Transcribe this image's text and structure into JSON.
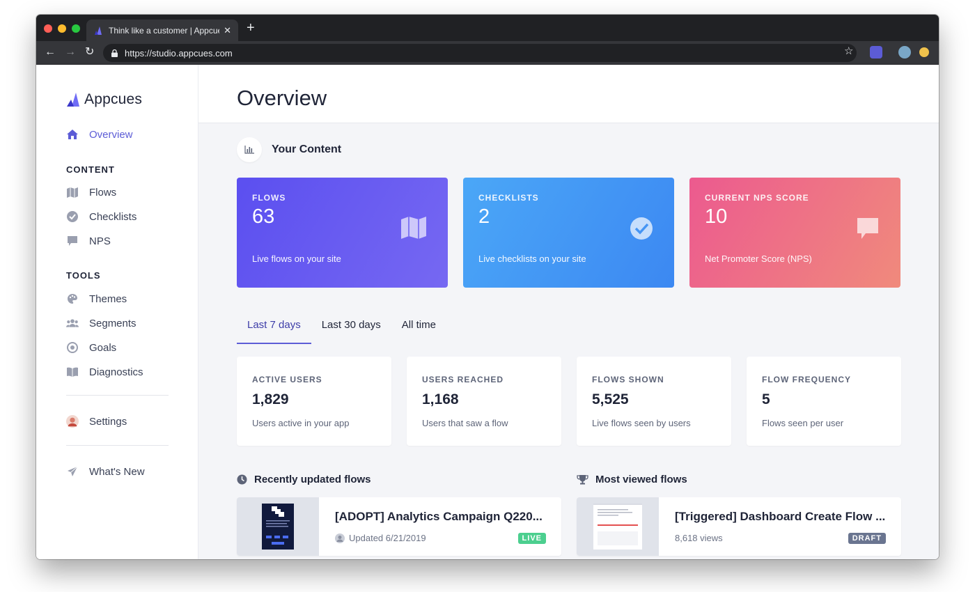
{
  "browser": {
    "tab_title": "Think like a customer | Appcues",
    "url": "https://studio.appcues.com",
    "traffic_lights": [
      "#ff5f57",
      "#febc2e",
      "#28c840"
    ]
  },
  "sidebar": {
    "logo_text": "Appcues",
    "overview_label": "Overview",
    "content_heading": "CONTENT",
    "content_items": [
      {
        "label": "Flows",
        "icon": "map-icon"
      },
      {
        "label": "Checklists",
        "icon": "check-circle-icon"
      },
      {
        "label": "NPS",
        "icon": "chat-bubble-icon"
      }
    ],
    "tools_heading": "TOOLS",
    "tools_items": [
      {
        "label": "Themes",
        "icon": "palette-icon"
      },
      {
        "label": "Segments",
        "icon": "users-icon"
      },
      {
        "label": "Goals",
        "icon": "target-icon"
      },
      {
        "label": "Diagnostics",
        "icon": "book-icon"
      }
    ],
    "settings_label": "Settings",
    "whats_new_label": "What's New"
  },
  "main": {
    "page_title": "Overview",
    "your_content_title": "Your Content",
    "cards": [
      {
        "label": "FLOWS",
        "value": "63",
        "sub": "Live flows on your site",
        "icon": "map-icon"
      },
      {
        "label": "CHECKLISTS",
        "value": "2",
        "sub": "Live checklists on your site",
        "icon": "check-circle-icon"
      },
      {
        "label": "CURRENT NPS SCORE",
        "value": "10",
        "sub": "Net Promoter Score (NPS)",
        "icon": "chat-bubble-icon"
      }
    ],
    "time_tabs": [
      "Last 7 days",
      "Last 30 days",
      "All time"
    ],
    "active_tab": "Last 7 days",
    "stats": [
      {
        "label": "ACTIVE USERS",
        "value": "1,829",
        "sub": "Users active in your app"
      },
      {
        "label": "USERS REACHED",
        "value": "1,168",
        "sub": "Users that saw a flow"
      },
      {
        "label": "FLOWS SHOWN",
        "value": "5,525",
        "sub": "Live flows seen by users"
      },
      {
        "label": "FLOW FREQUENCY",
        "value": "5",
        "sub": "Flows seen per user"
      }
    ],
    "recent_title": "Recently updated flows",
    "recent_flow": {
      "title": "[ADOPT] Analytics Campaign Q220...",
      "meta": "Updated 6/21/2019",
      "badge": "LIVE"
    },
    "most_viewed_title": "Most viewed flows",
    "viewed_flow": {
      "title": "[Triggered] Dashboard Create Flow ...",
      "meta": "8,618 views",
      "badge": "DRAFT"
    }
  },
  "colors": {
    "accent": "#5c5cd6",
    "flows_gradient": [
      "#5b4ff0",
      "#7668f2"
    ],
    "checklists_gradient": [
      "#4ba7f7",
      "#3c88f2"
    ],
    "nps_gradient": [
      "#ec5a8f",
      "#f08a7c"
    ],
    "live_badge": "#4ccf8f",
    "draft_badge": "#6a7590"
  }
}
